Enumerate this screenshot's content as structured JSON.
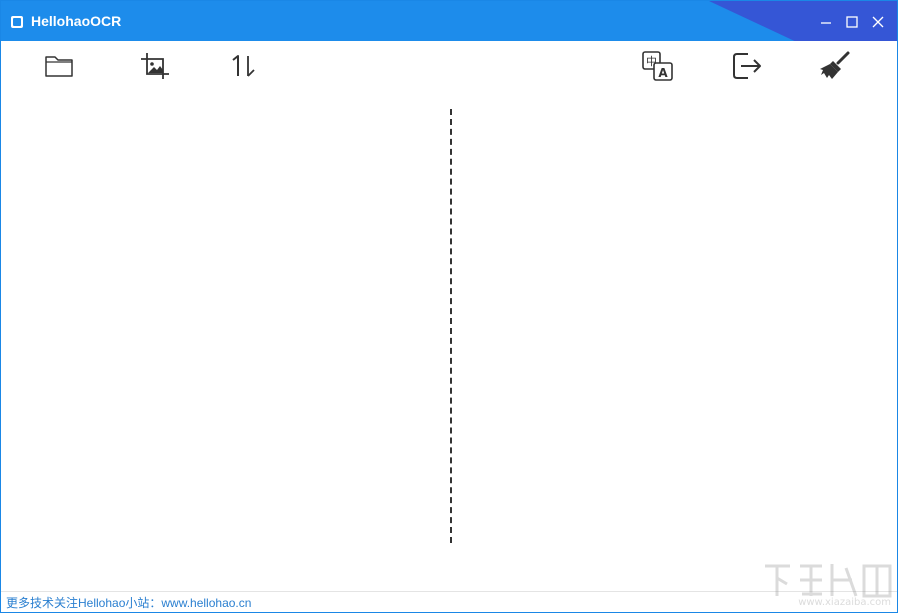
{
  "window": {
    "title": "HellohaoOCR"
  },
  "titlebar": {
    "controls": [
      {
        "name": "minimize",
        "icon": "minimize-icon"
      },
      {
        "name": "maximize",
        "icon": "maximize-icon"
      },
      {
        "name": "close",
        "icon": "close-icon"
      }
    ]
  },
  "toolbar": {
    "left_tools": [
      {
        "name": "open-folder",
        "icon": "folder-icon"
      },
      {
        "name": "screenshot-crop",
        "icon": "crop-image-icon"
      },
      {
        "name": "sort-swap",
        "icon": "sort-1-down-icon"
      }
    ],
    "right_tools": [
      {
        "name": "translate",
        "icon": "translate-icon",
        "glyph_top": "中",
        "glyph_bottom": "A"
      },
      {
        "name": "export",
        "icon": "export-icon"
      },
      {
        "name": "clear",
        "icon": "broom-icon"
      }
    ]
  },
  "status": {
    "text": "更多技术关注Hellohao小站：www.hellohao.cn"
  },
  "watermark": {
    "text": "www.xiazaiba.com"
  },
  "colors": {
    "titlebar": "#1d8ceb",
    "titlebar_accent": "#3556d6",
    "status_text": "#2a7fd0",
    "icon": "#333333"
  }
}
